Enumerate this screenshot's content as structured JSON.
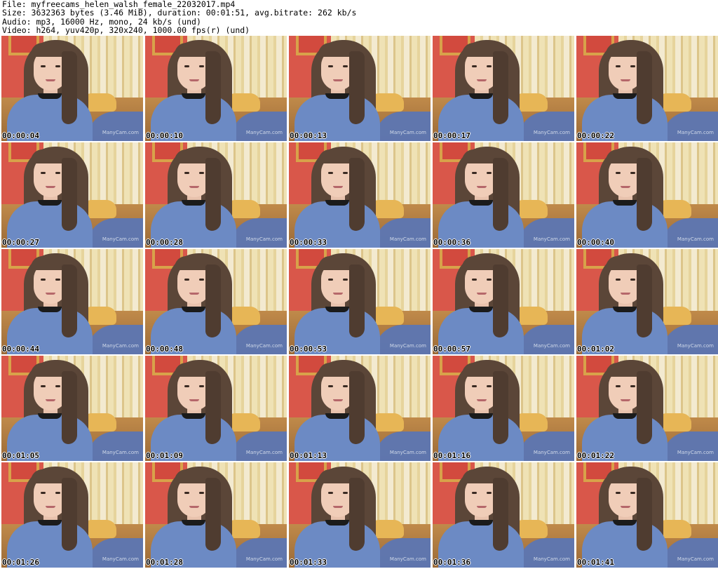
{
  "header": {
    "file": "File: myfreecams_helen_walsh_female_22032017.mp4",
    "size": "Size: 3632363 bytes (3.46 MiB), duration: 00:01:51, avg.bitrate: 262 kb/s",
    "audio": "Audio: mp3, 16000 Hz, mono, 24 kb/s (und)",
    "video": "Video: h264, yuv420p, 320x240, 1000.00 fps(r) (und)"
  },
  "thumbnails": [
    {
      "timestamp": "00:00:04"
    },
    {
      "timestamp": "00:00:10"
    },
    {
      "timestamp": "00:00:13"
    },
    {
      "timestamp": "00:00:17"
    },
    {
      "timestamp": "00:00:22"
    },
    {
      "timestamp": "00:00:27"
    },
    {
      "timestamp": "00:00:28"
    },
    {
      "timestamp": "00:00:33"
    },
    {
      "timestamp": "00:00:36"
    },
    {
      "timestamp": "00:00:40"
    },
    {
      "timestamp": "00:00:44"
    },
    {
      "timestamp": "00:00:48"
    },
    {
      "timestamp": "00:00:53"
    },
    {
      "timestamp": "00:00:57"
    },
    {
      "timestamp": "00:01:02"
    },
    {
      "timestamp": "00:01:05"
    },
    {
      "timestamp": "00:01:09"
    },
    {
      "timestamp": "00:01:13"
    },
    {
      "timestamp": "00:01:16"
    },
    {
      "timestamp": "00:01:22"
    },
    {
      "timestamp": "00:01:26"
    },
    {
      "timestamp": "00:01:28"
    },
    {
      "timestamp": "00:01:33"
    },
    {
      "timestamp": "00:01:36"
    },
    {
      "timestamp": "00:01:41"
    }
  ],
  "watermark": "ManyCam.com"
}
